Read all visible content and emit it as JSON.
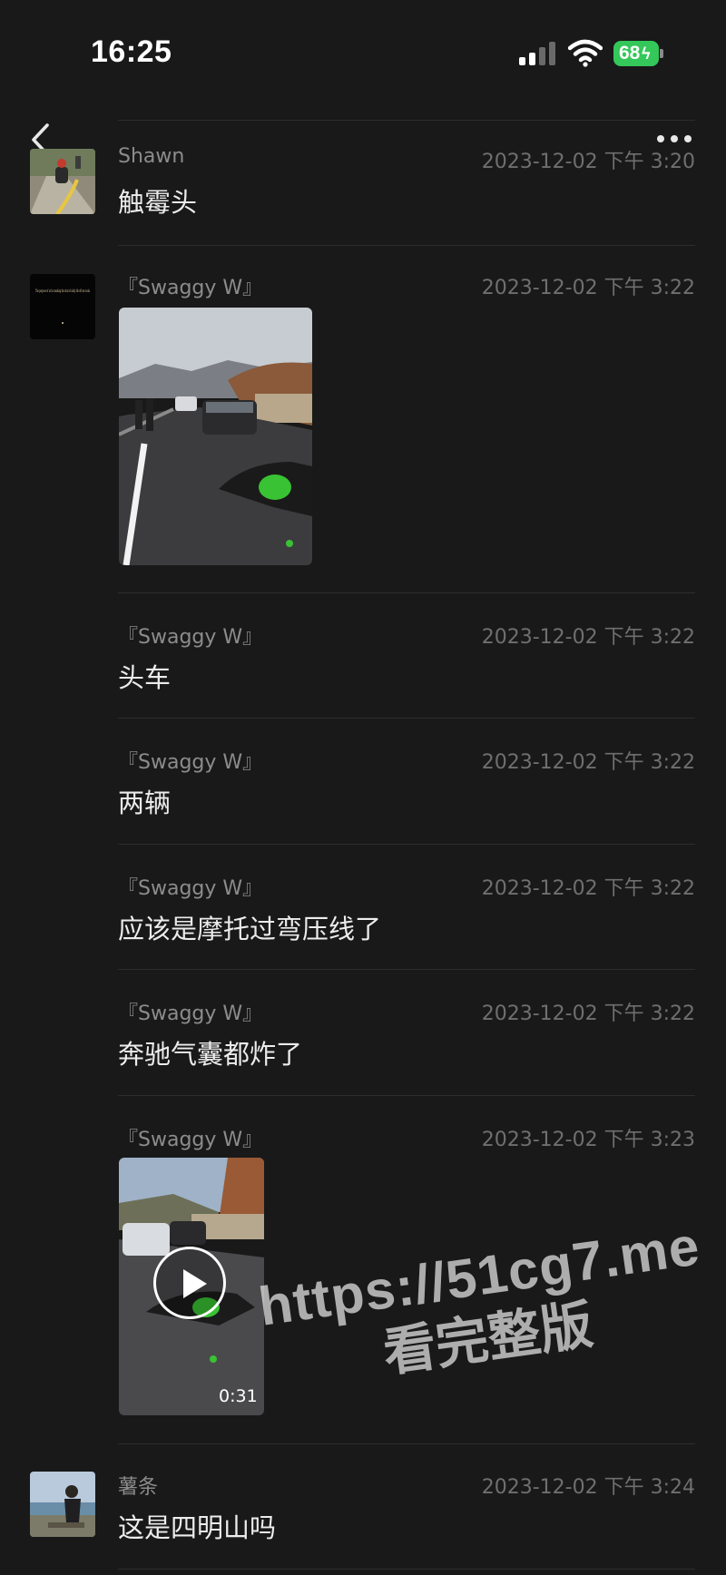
{
  "status_bar": {
    "time": "16:25",
    "battery": "68"
  },
  "messages": [
    {
      "name": "Shawn",
      "time": "2023-12-02 下午 3:20",
      "text": "触霉头"
    },
    {
      "name": "『Swaggy W』",
      "time": "2023-12-02 下午 3:22",
      "text": ""
    },
    {
      "name": "『Swaggy W』",
      "time": "2023-12-02 下午 3:22",
      "text": "头车"
    },
    {
      "name": "『Swaggy W』",
      "time": "2023-12-02 下午 3:22",
      "text": "两辆"
    },
    {
      "name": "『Swaggy W』",
      "time": "2023-12-02 下午 3:22",
      "text": "应该是摩托过弯压线了"
    },
    {
      "name": "『Swaggy W』",
      "time": "2023-12-02 下午 3:22",
      "text": "奔驰气囊都炸了"
    },
    {
      "name": "『Swaggy W』",
      "time": "2023-12-02 下午 3:23",
      "text": ""
    },
    {
      "name": "薯条",
      "time": "2023-12-02 下午 3:24",
      "text": "这是四明山吗"
    }
  ],
  "video": {
    "duration": "0:31"
  },
  "avatar_text": "The purpose of art is washing the dust of daily life off our souls",
  "watermark": {
    "url": "https://51cg7.me",
    "subtitle": "看完整版"
  },
  "icons": {
    "back": "chevron-left-icon",
    "more": "more-dots-icon",
    "signal": "cellular-signal-icon",
    "wifi": "wifi-icon",
    "battery": "battery-icon",
    "play": "play-icon"
  },
  "colors": {
    "background": "#191919",
    "battery": "#34c759",
    "accident_bike": "#39c234"
  }
}
